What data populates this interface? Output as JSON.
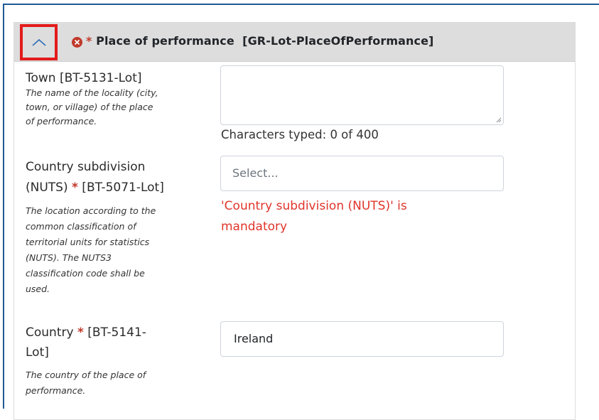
{
  "section": {
    "required_marker": "*",
    "title": "Place of performance  [GR-Lot-PlaceOfPerformance]",
    "collapse_icon": "chevron-up-icon",
    "error_icon": "error-circle-icon",
    "highlight_color": "#e31b1b",
    "header_bg": "#dddddd"
  },
  "town": {
    "label": "Town [BT-5131-Lot]",
    "help": [
      "The name of the locality (city,",
      "town, or village) of the place",
      "of performance."
    ],
    "value": "",
    "counter": "Characters typed: 0 of 400"
  },
  "nuts": {
    "label_line1": "Country subdivision",
    "label_line2_pre": "(NUTS) ",
    "required": "*",
    "label_line2_post": " [BT-5071-Lot]",
    "help": [
      "The location according to the",
      "common classification of",
      "territorial units for statistics",
      "(NUTS). The NUTS3",
      "classification code shall be",
      "used."
    ],
    "placeholder": "Select...",
    "error_line1": "'Country subdivision (NUTS)' is",
    "error_line2": "mandatory",
    "error_color": "#e0352b"
  },
  "country": {
    "label_pre": "Country ",
    "required": "*",
    "label_post": " [BT-5141-",
    "label_line2": "Lot]",
    "help": [
      "The country of the place of",
      "performance."
    ],
    "value": "Ireland"
  }
}
